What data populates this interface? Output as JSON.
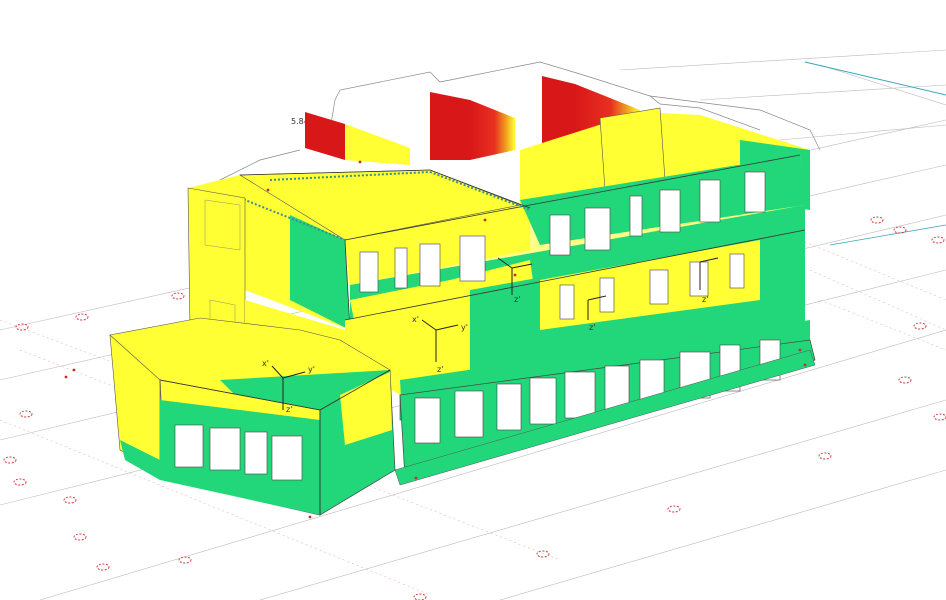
{
  "view": {
    "max_label": "5.8",
    "axis_labels": {
      "x": "x'",
      "y": "y'",
      "z": "z'"
    }
  },
  "colors": {
    "background": "#ffffff",
    "low": "#22d77a",
    "mid": "#ffff33",
    "high_mid": "#f0a020",
    "high": "#d81818",
    "grid": "#bbbbbb",
    "supports": "#d04040",
    "axis_line": "#3aa7b5"
  }
}
